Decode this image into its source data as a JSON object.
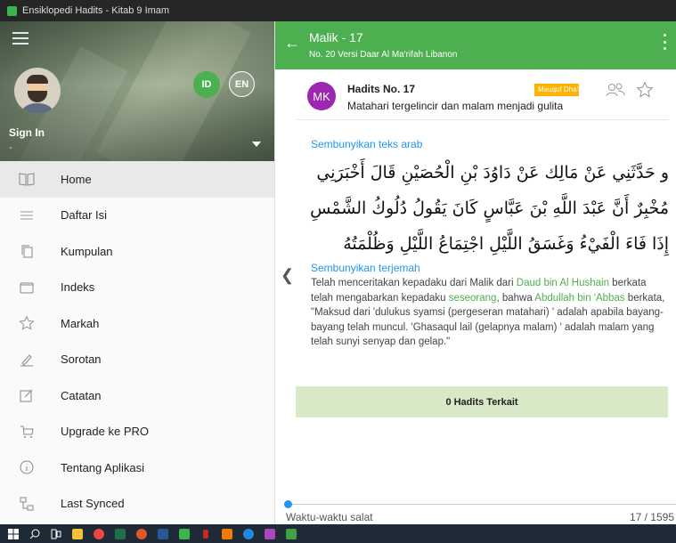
{
  "window": {
    "title": "Ensiklopedi Hadits - Kitab 9 Imam"
  },
  "drawer": {
    "lang_id": "ID",
    "lang_en": "EN",
    "signin_label": "Sign In",
    "signin_sub": "-",
    "items": [
      {
        "label": "Home",
        "icon": "book-open-icon"
      },
      {
        "label": "Daftar Isi",
        "icon": "list-lines-icon"
      },
      {
        "label": "Kumpulan",
        "icon": "stack-icon"
      },
      {
        "label": "Indeks",
        "icon": "folder-icon"
      },
      {
        "label": "Markah",
        "icon": "star-outline-icon"
      },
      {
        "label": "Sorotan",
        "icon": "highlighter-icon"
      },
      {
        "label": "Catatan",
        "icon": "note-edit-icon"
      },
      {
        "label": "Upgrade ke PRO",
        "icon": "cart-icon"
      },
      {
        "label": "Tentang Aplikasi",
        "icon": "info-icon"
      },
      {
        "label": "Last Synced",
        "icon": "sync-network-icon"
      }
    ]
  },
  "appbar": {
    "title": "Malik - 17",
    "subtitle": "No. 20 Versi Daar Al Ma'rifah Libanon"
  },
  "hadith": {
    "avatar_initials": "MK",
    "number_label": "Hadits No. 17",
    "description": "Matahari tergelincir dan malam menjadi gulita",
    "badge": "Mauquf Dha'if",
    "toggle_arab": "Sembunyikan teks arab",
    "arabic": "و حَدَّثَنِي عَنْ مَالِك عَنْ دَاوُدَ بْنِ الْحُصَيْنِ قَالَ أَخْبَرَنِي مُخْبِرٌ أَنَّ عَبْدَ اللَّهِ بْنَ عَبَّاسٍ كَانَ يَقُولُ دُلُوكُ الشَّمْسِ إِذَا فَاءَ الْفَيْءُ وَغَسَقُ اللَّيْلِ اجْتِمَاعُ اللَّيْلِ وَظُلْمَتُهُ",
    "toggle_terjemah": "Sembunyikan terjemah",
    "terjemah": {
      "part1": "Telah menceritakan kepadaku dari Malik dari ",
      "link1": "Daud bin Al Hushain",
      "part2": " berkata telah mengabarkan kepadaku ",
      "link2": "seseorang",
      "part3": ", bahwa ",
      "link3": "Abdullah bin 'Abbas",
      "part4": " berkata, \"Maksud dari 'dulukus syamsi (pergeseran matahari) ' adalah apabila bayang-bayang telah muncul. 'Ghasaqul lail (gelapnya malam) ' adalah malam yang telah sunyi senyap dan gelap.\""
    },
    "related_label": "0 Hadits Terkait"
  },
  "footer": {
    "bab": "Waktu-waktu salat",
    "page": "17 / 1595",
    "progress_fraction": 0.0107
  },
  "colors": {
    "accent": "#4caf50",
    "link": "#2196f3",
    "avatar": "#9c27b0",
    "badge": "#ffb300"
  }
}
